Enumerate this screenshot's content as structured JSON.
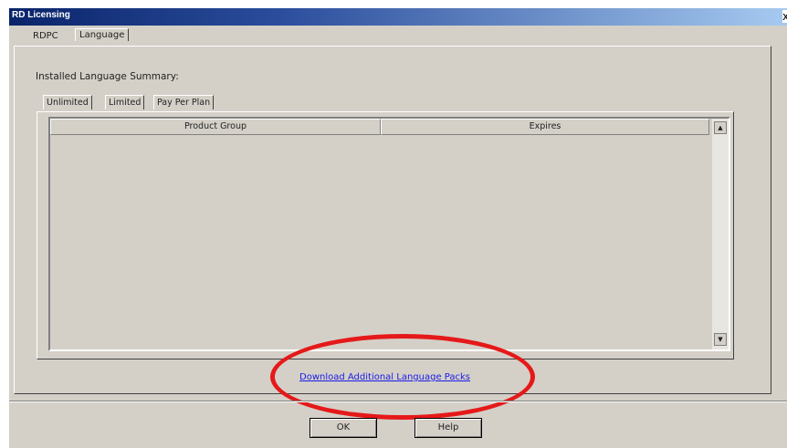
{
  "window": {
    "title": "RD Licensing",
    "close_label": "x"
  },
  "tabs": {
    "rdpc": "RDPC",
    "language": "Language"
  },
  "summary_label": "Installed Language Summary:",
  "inner_tabs": [
    "Unlimited",
    "Limited",
    "Pay Per Plan"
  ],
  "grid": {
    "columns": [
      "Product Group",
      "Expires"
    ],
    "rows": []
  },
  "link": {
    "label": "Download Additional Language Packs"
  },
  "buttons": {
    "ok": "OK",
    "help": "Help"
  },
  "colors": {
    "accent": "#0a246a",
    "link": "#1a1ae6",
    "highlight": "#e51919"
  }
}
